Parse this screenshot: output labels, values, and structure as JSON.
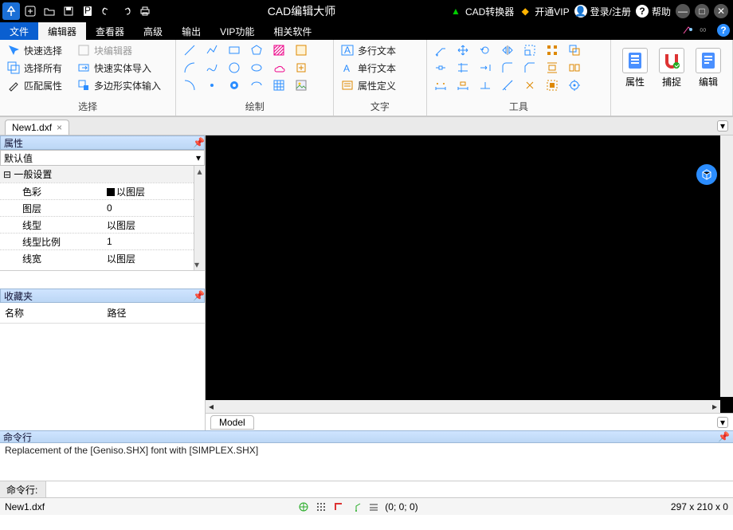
{
  "titlebar": {
    "app_title": "CAD编辑大师",
    "converter": "CAD转换器",
    "vip": "开通VIP",
    "login": "登录/注册",
    "help": "帮助"
  },
  "menu": {
    "file": "文件",
    "editor": "编辑器",
    "viewer": "查看器",
    "advanced": "高级",
    "output": "输出",
    "vip": "VIP功能",
    "related": "相关软件"
  },
  "ribbon": {
    "select": {
      "quick": "快速选择",
      "block_editor": "块编辑器",
      "select_all": "选择所有",
      "fast_entity_import": "快速实体导入",
      "match_prop": "匹配属性",
      "polygon_entity_input": "多边形实体输入",
      "label": "选择"
    },
    "draw": {
      "label": "绘制"
    },
    "text": {
      "multi": "多行文本",
      "single": "单行文本",
      "attrdef": "属性定义",
      "label": "文字"
    },
    "tools": {
      "label": "工具"
    },
    "big": {
      "prop": "属性",
      "snap": "捕捉",
      "edit": "编辑"
    }
  },
  "doc": {
    "tab1": "New1.dxf"
  },
  "prop": {
    "title": "属性",
    "default": "默认值",
    "general": "一般设置",
    "rows": {
      "color": {
        "k": "色彩",
        "v": "以图层"
      },
      "layer": {
        "k": "图层",
        "v": "0"
      },
      "linetype": {
        "k": "线型",
        "v": "以图层"
      },
      "ltscale": {
        "k": "线型比例",
        "v": "1"
      },
      "lineweight": {
        "k": "线宽",
        "v": "以图层"
      }
    }
  },
  "fav": {
    "title": "收藏夹",
    "name": "名称",
    "path": "路径"
  },
  "model": {
    "tab": "Model"
  },
  "cmd": {
    "title": "命令行",
    "log": "Replacement of the [Geniso.SHX] font with [SIMPLEX.SHX]",
    "label": "命令行:"
  },
  "status": {
    "file": "New1.dxf",
    "coords": "(0; 0; 0)",
    "dims": "297 x 210 x 0"
  }
}
